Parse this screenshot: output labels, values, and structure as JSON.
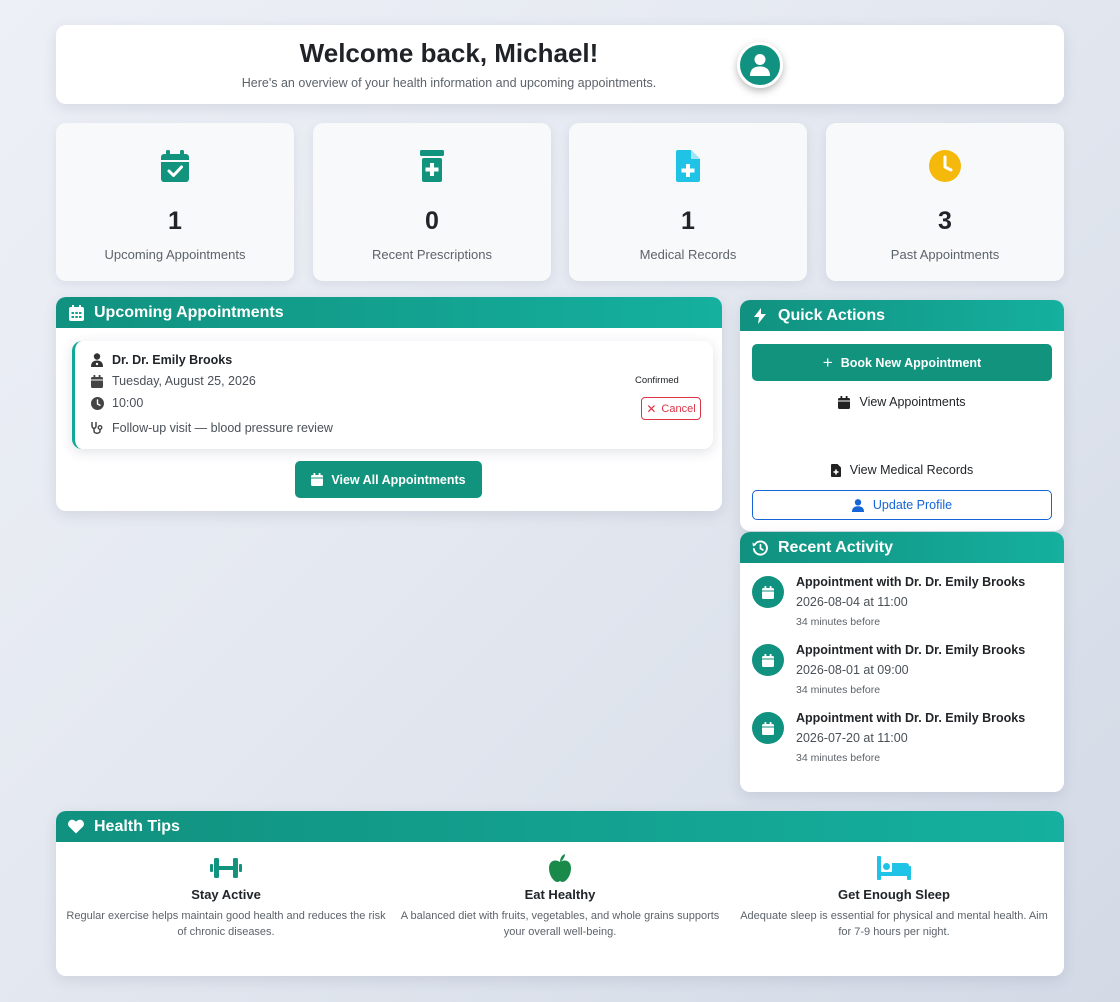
{
  "header": {
    "title": "Welcome back, Michael!",
    "subtitle": "Here's an overview of your health information and upcoming appointments.",
    "avatar_icon": "user-icon"
  },
  "stats": [
    {
      "icon": "calendar-check-icon",
      "value": "1",
      "label": "Upcoming Appointments",
      "color": "#12937d"
    },
    {
      "icon": "prescription-bottle-icon",
      "value": "0",
      "label": "Recent Prescriptions",
      "color": "#12937d"
    },
    {
      "icon": "file-medical-icon",
      "value": "1",
      "label": "Medical Records",
      "color": "#1ec3e6"
    },
    {
      "icon": "clock-icon",
      "value": "3",
      "label": "Past Appointments",
      "color": "#f5b90b"
    }
  ],
  "upcoming": {
    "title": "Upcoming Appointments",
    "appointment": {
      "doctor": "Dr. Dr. Emily Brooks",
      "date": "Tuesday, August 25, 2026",
      "time": "10:00",
      "reason": "Follow-up visit — blood pressure review",
      "status": "Confirmed",
      "cancel_label": "Cancel"
    },
    "view_all_label": "View All Appointments"
  },
  "quick_actions": {
    "title": "Quick Actions",
    "book_label": "Book New Appointment",
    "view_appointments_label": "View Appointments",
    "view_records_label": "View Medical Records",
    "update_profile_label": "Update Profile"
  },
  "activity": {
    "title": "Recent Activity",
    "items": [
      {
        "title": "Appointment with Dr. Dr. Emily Brooks",
        "when": "2026-08-04 at 11:00",
        "ago": "34 minutes before"
      },
      {
        "title": "Appointment with Dr. Dr. Emily Brooks",
        "when": "2026-08-01 at 09:00",
        "ago": "34 minutes before"
      },
      {
        "title": "Appointment with Dr. Dr. Emily Brooks",
        "when": "2026-07-20 at 11:00",
        "ago": "34 minutes before"
      }
    ]
  },
  "tips": {
    "title": "Health Tips",
    "items": [
      {
        "icon": "dumbbell-icon",
        "title": "Stay Active",
        "text": "Regular exercise helps maintain good health and reduces the risk of chronic diseases.",
        "color": "#12937d"
      },
      {
        "icon": "apple-icon",
        "title": "Eat Healthy",
        "text": "A balanced diet with fruits, vegetables, and whole grains supports your overall well-being.",
        "color": "#1a8a4a"
      },
      {
        "icon": "bed-icon",
        "title": "Get Enough Sleep",
        "text": "Adequate sleep is essential for physical and mental health. Aim for 7-9 hours per night.",
        "color": "#1ec3e6"
      }
    ]
  }
}
